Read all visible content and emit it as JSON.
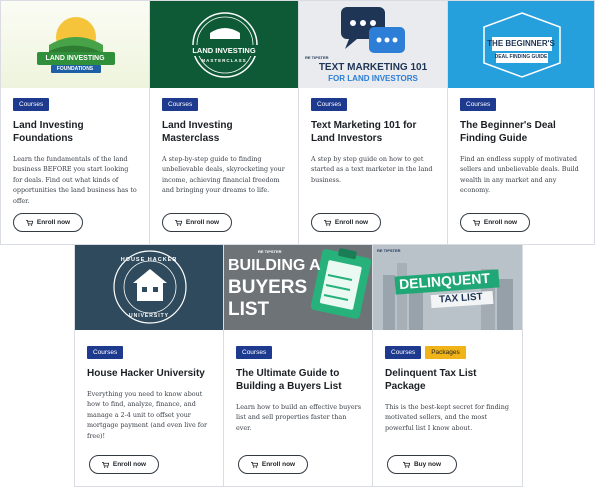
{
  "courses": [
    {
      "thumb_text": "LAND INVESTING",
      "thumb_sub": "FOUNDATIONS",
      "badges": [
        "Courses"
      ],
      "title": "Land Investing Foundations",
      "description": "Learn the fundamentals of the land business BEFORE you start looking for deals. Find out what kinds of opportunities the land business has to offer.",
      "button": "Enroll now"
    },
    {
      "thumb_text": "LAND INVESTING",
      "thumb_sub": "MASTERCLASS",
      "badges": [
        "Courses"
      ],
      "title": "Land Investing Masterclass",
      "description": "A step-by-step guide to finding unbelievable deals, skyrocketing your income, achieving financial freedom and bringing your dreams to life.",
      "button": "Enroll now"
    },
    {
      "thumb_brand": "RE TIPSTER",
      "thumb_text": "TEXT MARKETING 101",
      "thumb_sub": "FOR LAND INVESTORS",
      "badges": [
        "Courses"
      ],
      "title": "Text Marketing 101 for Land Investors",
      "description": "A step by step guide on how to get started as a text marketer in the land business.",
      "button": "Enroll now"
    },
    {
      "thumb_text": "THE BEGINNER'S",
      "thumb_sub": "DEAL FINDING GUIDE",
      "badges": [
        "Courses"
      ],
      "title": "The Beginner's Deal Finding Guide",
      "description": "Find an endless supply of motivated sellers and unbelievable deals. Build wealth in any market and any economy.",
      "button": "Enroll now"
    },
    {
      "thumb_text": "HOUSE HACKER",
      "thumb_sub": "UNIVERSITY",
      "badges": [
        "Courses"
      ],
      "title": "House Hacker University",
      "description": "Everything you need to know about how to find, analyze, finance, and manage a 2-4 unit to offset your mortgage payment (and even live for free)!",
      "button": "Enroll now"
    },
    {
      "thumb_brand": "RE TIPSTER",
      "thumb_text": "BUILDING A",
      "thumb_sub": "BUYERS LIST",
      "badges": [
        "Courses"
      ],
      "title": "The Ultimate Guide to Building a Buyers List",
      "description": "Learn how to build an effective buyers list and sell properties faster than ever.",
      "button": "Enroll now"
    },
    {
      "thumb_brand": "RE TIPSTER",
      "thumb_text": "DELINQUENT",
      "thumb_sub": "TAX LIST",
      "badges": [
        "Courses",
        "Packages"
      ],
      "title": "Delinquent Tax List Package",
      "description": "This is the best-kept secret for finding motivated sellers, and the most powerful list I know about.",
      "button": "Buy now"
    }
  ],
  "colors": {
    "badge_courses": "#1d3a8f",
    "badge_packages": "#f0b419",
    "masterclass_green": "#0f5a36",
    "beginner_blue": "#25a0dd"
  }
}
